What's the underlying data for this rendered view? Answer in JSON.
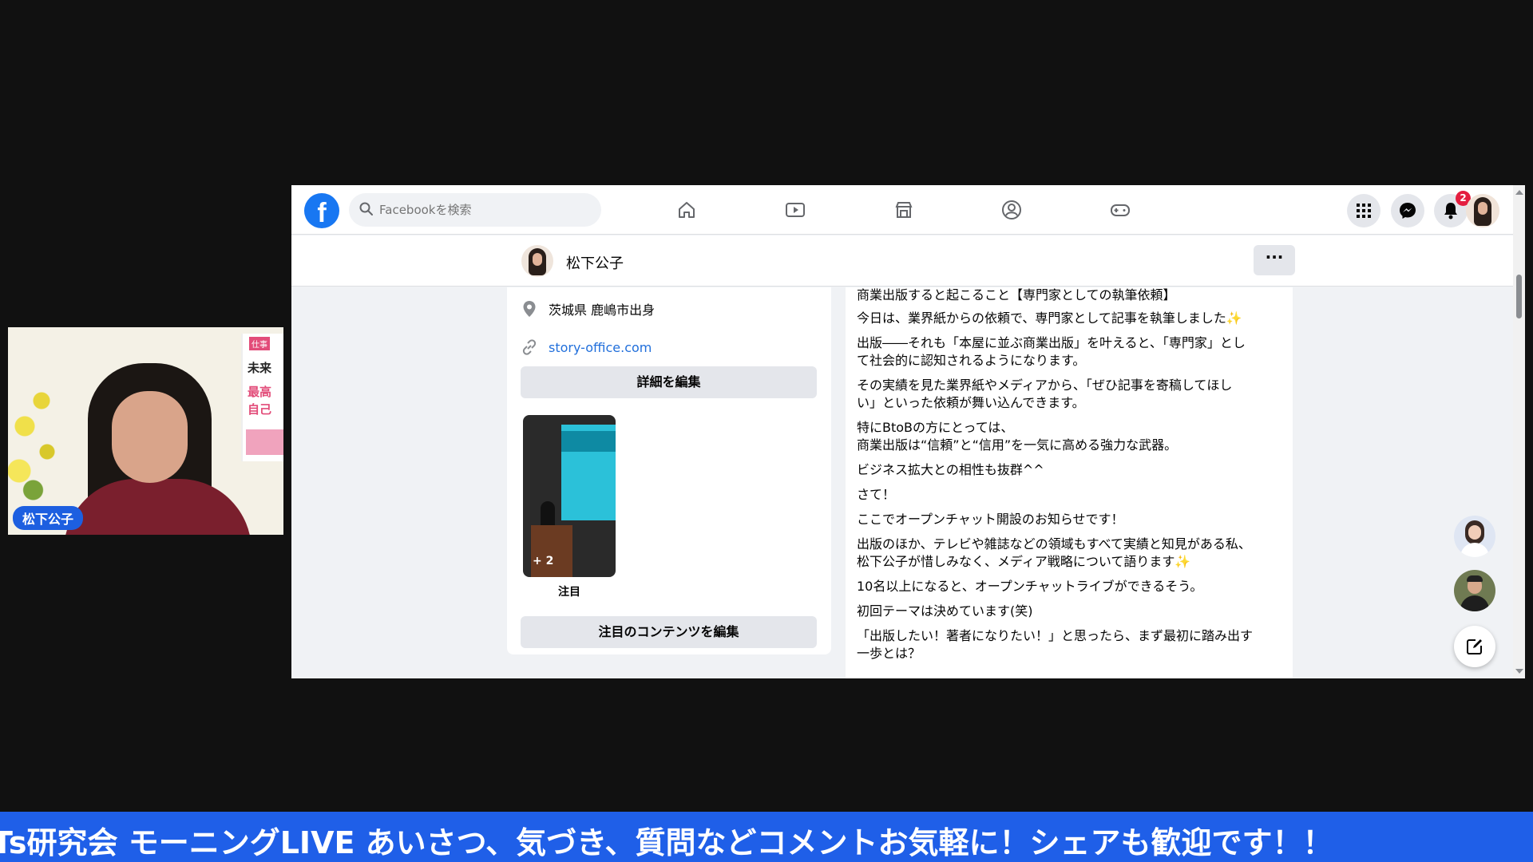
{
  "webcam": {
    "participant_name": "松下公子",
    "book_cover_lines": [
      "仕事",
      "未来",
      "最高",
      "自己"
    ]
  },
  "facebook": {
    "logo": "f",
    "search_placeholder": "Facebookを検索",
    "notifications_count": "2",
    "profile_name": "松下公子",
    "more_label": "···",
    "intro": {
      "location": "茨城県 鹿嶋市出身",
      "website": "story-office.com",
      "edit_details_label": "詳細を編集",
      "featured_more": "+ 2",
      "featured_label": "注目",
      "edit_featured_label": "注目のコンテンツを編集"
    },
    "post_lines": [
      "商業出版すると起こること【専門家としての執筆依頼】",
      "今日は、業界紙からの依頼で、専門家として記事を執筆しました✨",
      "出版――それも「本屋に並ぶ商業出版」を叶えると、「専門家」とし",
      "て社会的に認知されるようになります。",
      "その実績を見た業界紙やメディアから、「ぜひ記事を寄稿してほし",
      "い」といった依頼が舞い込んできます。",
      "特にBtoBの方にとっては、",
      "商業出版は“信頼”と“信用”を一気に高める強力な武器。",
      "ビジネス拡大との相性も抜群^^",
      "さて！",
      "ここでオープンチャット開設のお知らせです！",
      "出版のほか、テレビや雑誌などの領域もすべて実績と知見がある私、",
      "松下公子が惜しみなく、メディア戦略について語ります✨",
      "10名以上になると、オープンチャットライブができるそう。",
      "初回テーマは決めています(笑)",
      "「出版したい！著者になりたい！」と思ったら、まず最初に踏み出す",
      "一歩とは？"
    ]
  },
  "ticker": {
    "text": "Ts研究会 モーニングLIVE あいさつ、気づき、質問などコメントお気軽に！シェアも歓迎です！！"
  },
  "colors": {
    "facebook_blue": "#1877f2",
    "ticker_blue": "#1f5fe8",
    "badge_red": "#e41e3f",
    "link_blue": "#216fdb",
    "background": "#111111"
  },
  "icons": [
    "search-icon",
    "home-icon",
    "video-icon",
    "marketplace-icon",
    "groups-icon",
    "gaming-icon",
    "menu-grid-icon",
    "messenger-icon",
    "bell-icon",
    "location-pin-icon",
    "link-icon",
    "compose-icon"
  ]
}
